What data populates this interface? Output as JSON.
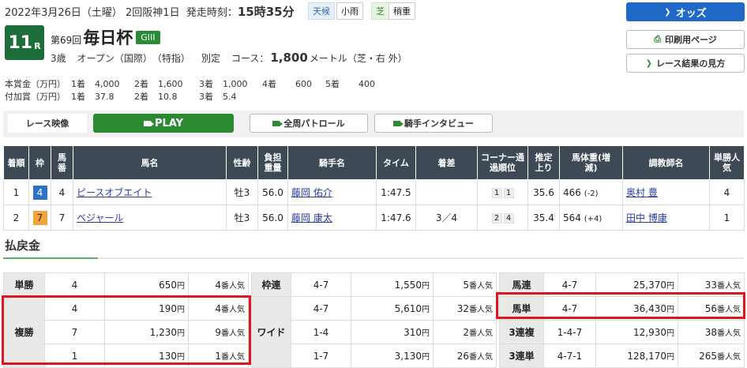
{
  "header": {
    "date": "2022年3月26日（土曜） 2回阪神1日",
    "start_label": "発走時刻：",
    "start_time": "15時35分",
    "weather_label": "天候",
    "weather": "小雨",
    "track_label": "芝",
    "track_cond": "稍重",
    "race_no": "11",
    "race_no_suffix": "R",
    "edition": "第69回",
    "race_name": "毎日杯",
    "grade": "GIII",
    "cond": [
      "3歳",
      "オープン（国際）",
      "（特指）",
      "別定"
    ],
    "course_label": "コース：",
    "distance": "1,800",
    "distance_unit": "メートル（芝・右 外）"
  },
  "prizes": {
    "main_label": "本賞金（万円）",
    "main": [
      [
        "1着",
        "4,000"
      ],
      [
        "2着",
        "1,600"
      ],
      [
        "3着",
        "1,000"
      ],
      [
        "4着",
        "600"
      ],
      [
        "5着",
        "400"
      ]
    ],
    "extra_label": "付加賞（万円）",
    "extra": [
      [
        "1着",
        "37.8"
      ],
      [
        "2着",
        "10.8"
      ],
      [
        "3着",
        "5.4"
      ]
    ]
  },
  "buttons": {
    "odds": "オッズ",
    "print": "印刷用ページ",
    "guide": "レース結果の見方"
  },
  "media": {
    "video": "レース映像",
    "play": "PLAY",
    "patrol": "全周パトロール",
    "interview": "騎手インタビュー"
  },
  "results": {
    "headers": [
      "着順",
      "枠",
      "馬番",
      "馬名",
      "性齢",
      "負担重量",
      "騎手名",
      "タイム",
      "着差",
      "コーナー通過順位",
      "推定上り",
      "馬体重(増減)",
      "調教師名",
      "単勝人気"
    ],
    "rows": [
      {
        "pos": "1",
        "waku": "4",
        "num": "4",
        "horse": "ピースオブエイト",
        "sex_age": "牡3",
        "weight": "56.0",
        "jockey": "藤岡 佑介",
        "time": "1:47.5",
        "margin": "",
        "corner1": "1",
        "corner2": "1",
        "last3f": "35.6",
        "body": "466",
        "body_diff": "(-2)",
        "trainer": "奥村 豊",
        "pop": "4"
      },
      {
        "pos": "2",
        "waku": "7",
        "num": "7",
        "horse": "ベジャール",
        "sex_age": "牡3",
        "weight": "56.0",
        "jockey": "藤岡 康太",
        "time": "1:47.6",
        "margin": "3／4",
        "corner1": "2",
        "corner2": "4",
        "last3f": "35.4",
        "body": "564",
        "body_diff": "(+4)",
        "trainer": "田中 博康",
        "pop": "1"
      }
    ]
  },
  "payout": {
    "title": "払戻金",
    "yen": "円",
    "pop_suffix": "番人気",
    "tansho": {
      "label": "単勝",
      "combo": "4",
      "amount": "650",
      "pop": "4"
    },
    "fukusho": {
      "label": "複勝",
      "rows": [
        [
          "4",
          "190",
          "4"
        ],
        [
          "7",
          "1,230",
          "9"
        ],
        [
          "1",
          "130",
          "1"
        ]
      ]
    },
    "wakuren": {
      "label": "枠連",
      "combo": "4-7",
      "amount": "1,550",
      "pop": "5"
    },
    "wide": {
      "label": "ワイド",
      "rows": [
        [
          "4-7",
          "5,610",
          "32"
        ],
        [
          "1-4",
          "310",
          "2"
        ],
        [
          "1-7",
          "3,130",
          "26"
        ]
      ]
    },
    "umaren": {
      "label": "馬連",
      "combo": "4-7",
      "amount": "25,370",
      "pop": "33"
    },
    "umatan": {
      "label": "馬単",
      "combo": "4-7",
      "amount": "36,430",
      "pop": "56"
    },
    "sanrenpuku": {
      "label": "3連複",
      "combo": "1-4-7",
      "amount": "12,930",
      "pop": "38"
    },
    "sanrentan": {
      "label": "3連単",
      "combo": "4-7-1",
      "amount": "128,170",
      "pop": "265"
    }
  }
}
